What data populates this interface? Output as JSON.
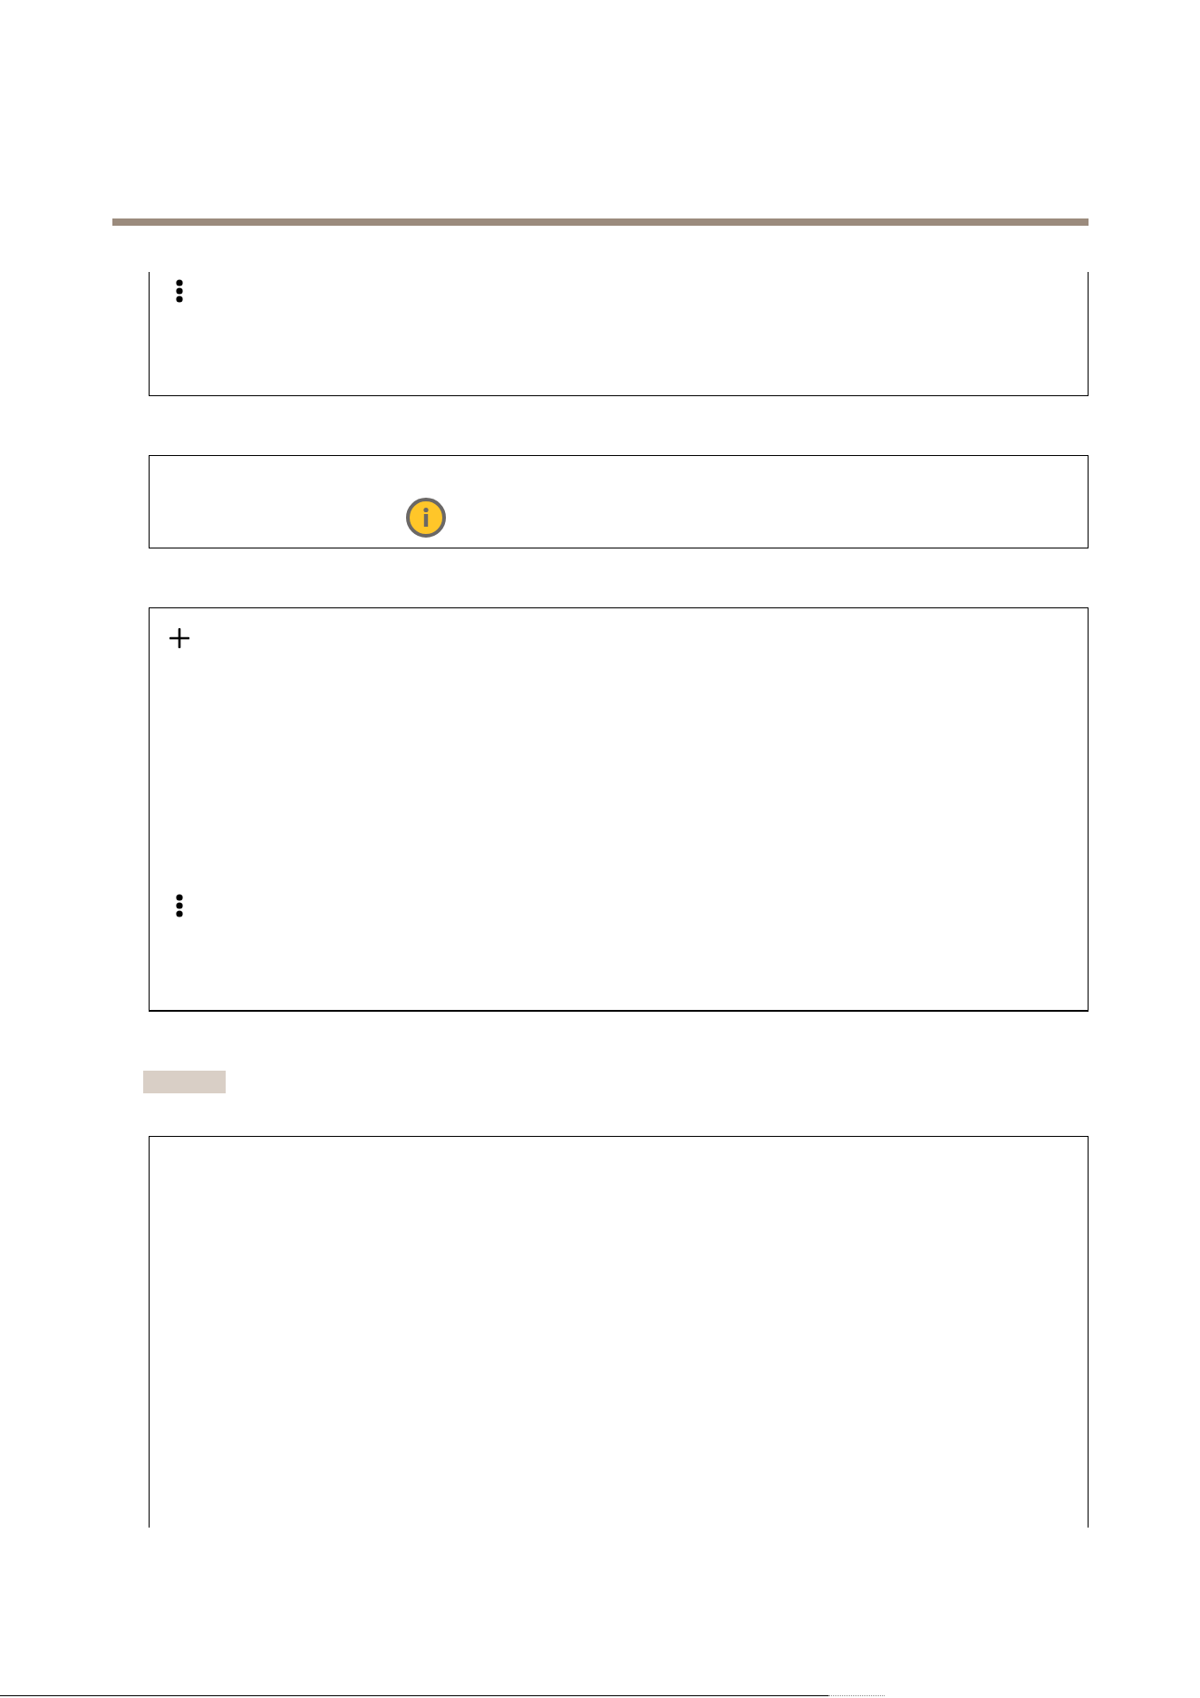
{
  "blocks": [
    {
      "kind": "panel",
      "cut_top": true,
      "cut_bottom": false,
      "icons": [
        {
          "kind": "more"
        }
      ]
    },
    {
      "kind": "note",
      "cut_top": false,
      "cut_bottom": false,
      "icons": [
        {
          "kind": "info"
        }
      ]
    },
    {
      "kind": "panel",
      "cut_top": false,
      "cut_bottom": false,
      "icons": [
        {
          "kind": "add"
        },
        {
          "kind": "more"
        }
      ]
    },
    {
      "kind": "tag"
    },
    {
      "kind": "panel",
      "cut_top": false,
      "cut_bottom": true
    }
  ]
}
